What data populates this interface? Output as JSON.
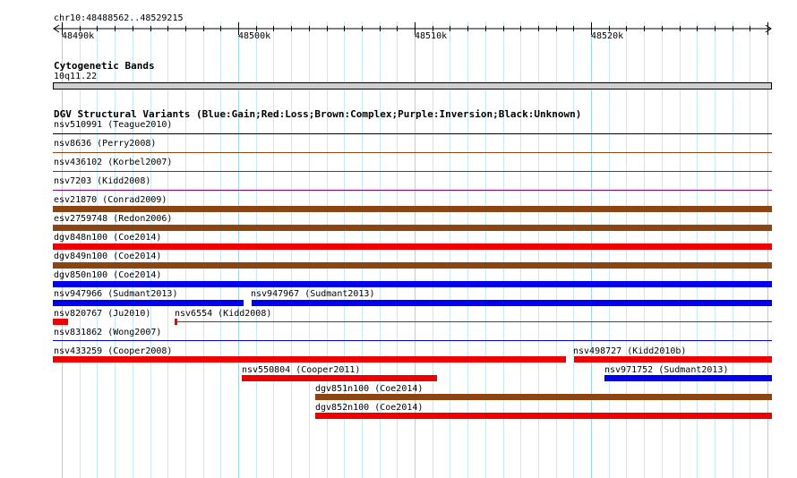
{
  "ruler": {
    "location": "chr10:48488562..48529215",
    "ticks": [
      "48490k",
      "48500k",
      "48510k",
      "48520k"
    ]
  },
  "cytobands": {
    "title": "Cytogenetic Bands",
    "band": "10q11.22"
  },
  "dgv": {
    "title": "DGV Structural Variants (Blue:Gain;Red:Loss;Brown:Complex;Purple:Inversion;Black:Unknown)",
    "colors": {
      "gain": "#0000ee",
      "loss": "#ee0000",
      "complex": "#8b4513",
      "inversion": "#800080",
      "unknown": "#000000"
    },
    "variants": [
      {
        "label": "nsv510991 (Teague2010)",
        "type": "unknown"
      },
      {
        "label": "nsv8636 (Perry2008)",
        "type": "complex"
      },
      {
        "label": "nsv436102 (Korbel2007)",
        "type": "loss"
      },
      {
        "label": "nsv7203 (Kidd2008)",
        "type": "inversion"
      },
      {
        "label": "esv21870 (Conrad2009)",
        "type": "complex"
      },
      {
        "label": "esv2759748 (Redon2006)",
        "type": "complex"
      },
      {
        "label": "dgv848n100 (Coe2014)",
        "type": "loss"
      },
      {
        "label": "dgv849n100 (Coe2014)",
        "type": "complex"
      },
      {
        "label": "dgv850n100 (Coe2014)",
        "type": "gain"
      },
      {
        "label": "nsv947966 (Sudmant2013)",
        "type": "gain"
      },
      {
        "label": "nsv947967 (Sudmant2013)",
        "type": "gain"
      },
      {
        "label": "nsv820767 (Ju2010)",
        "type": "loss"
      },
      {
        "label": "nsv6554 (Kidd2008)",
        "type": "loss"
      },
      {
        "label": "nsv831862 (Wong2007)",
        "type": "gain"
      },
      {
        "label": "nsv433259 (Cooper2008)",
        "type": "loss"
      },
      {
        "label": "nsv498727 (Kidd2010b)",
        "type": "loss"
      },
      {
        "label": "nsv550804 (Cooper2011)",
        "type": "loss"
      },
      {
        "label": "nsv971752 (Sudmant2013)",
        "type": "gain"
      },
      {
        "label": "dgv851n100 (Coe2014)",
        "type": "complex"
      },
      {
        "label": "dgv852n100 (Coe2014)",
        "type": "loss"
      }
    ]
  }
}
